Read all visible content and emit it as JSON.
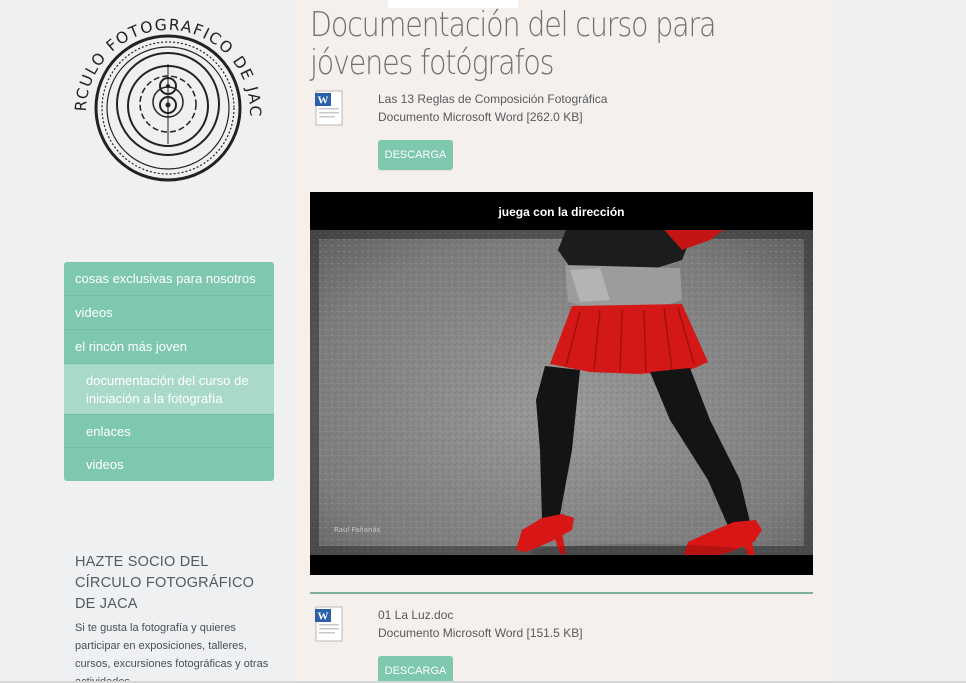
{
  "logo": {
    "text": "CIRCULO FOTOGRAFICO DE JACA"
  },
  "nav": {
    "items": [
      {
        "label": "cosas exclusivas para nosotros"
      },
      {
        "label": "videos"
      },
      {
        "label": "el rincón más joven"
      },
      {
        "label": "documentación del curso de iniciación a la fotografía",
        "active": true
      },
      {
        "label": "enlaces"
      },
      {
        "label": "videos"
      }
    ]
  },
  "promo": {
    "title": "HAZTE SOCIO DEL CÍRCULO FOTOGRÁFICO DE JACA",
    "text": "Si te gusta la fotografía y quieres participar en exposiciones, talleres, cursos, excursiones fotográficas y otras actividades,"
  },
  "page": {
    "title": "Documentación del curso para jóvenes fotógrafos"
  },
  "documents": [
    {
      "name": "Las 13 Reglas de Composición Fotográfica",
      "meta": "Documento Microsoft Word [262.0 KB]",
      "button": "DESCARGA"
    },
    {
      "name": "01 La Luz.doc",
      "meta": "Documento Microsoft Word [151.5 KB]",
      "button": "DESCARGA"
    }
  ],
  "photo": {
    "caption": "juega con la dirección",
    "watermark": "Raul Fañanás"
  },
  "colors": {
    "accent": "#7ec8ae",
    "accent_active": "#a9dac8",
    "content_bg": "#f6f0ed",
    "sidebar_bg": "#eff0f2"
  }
}
